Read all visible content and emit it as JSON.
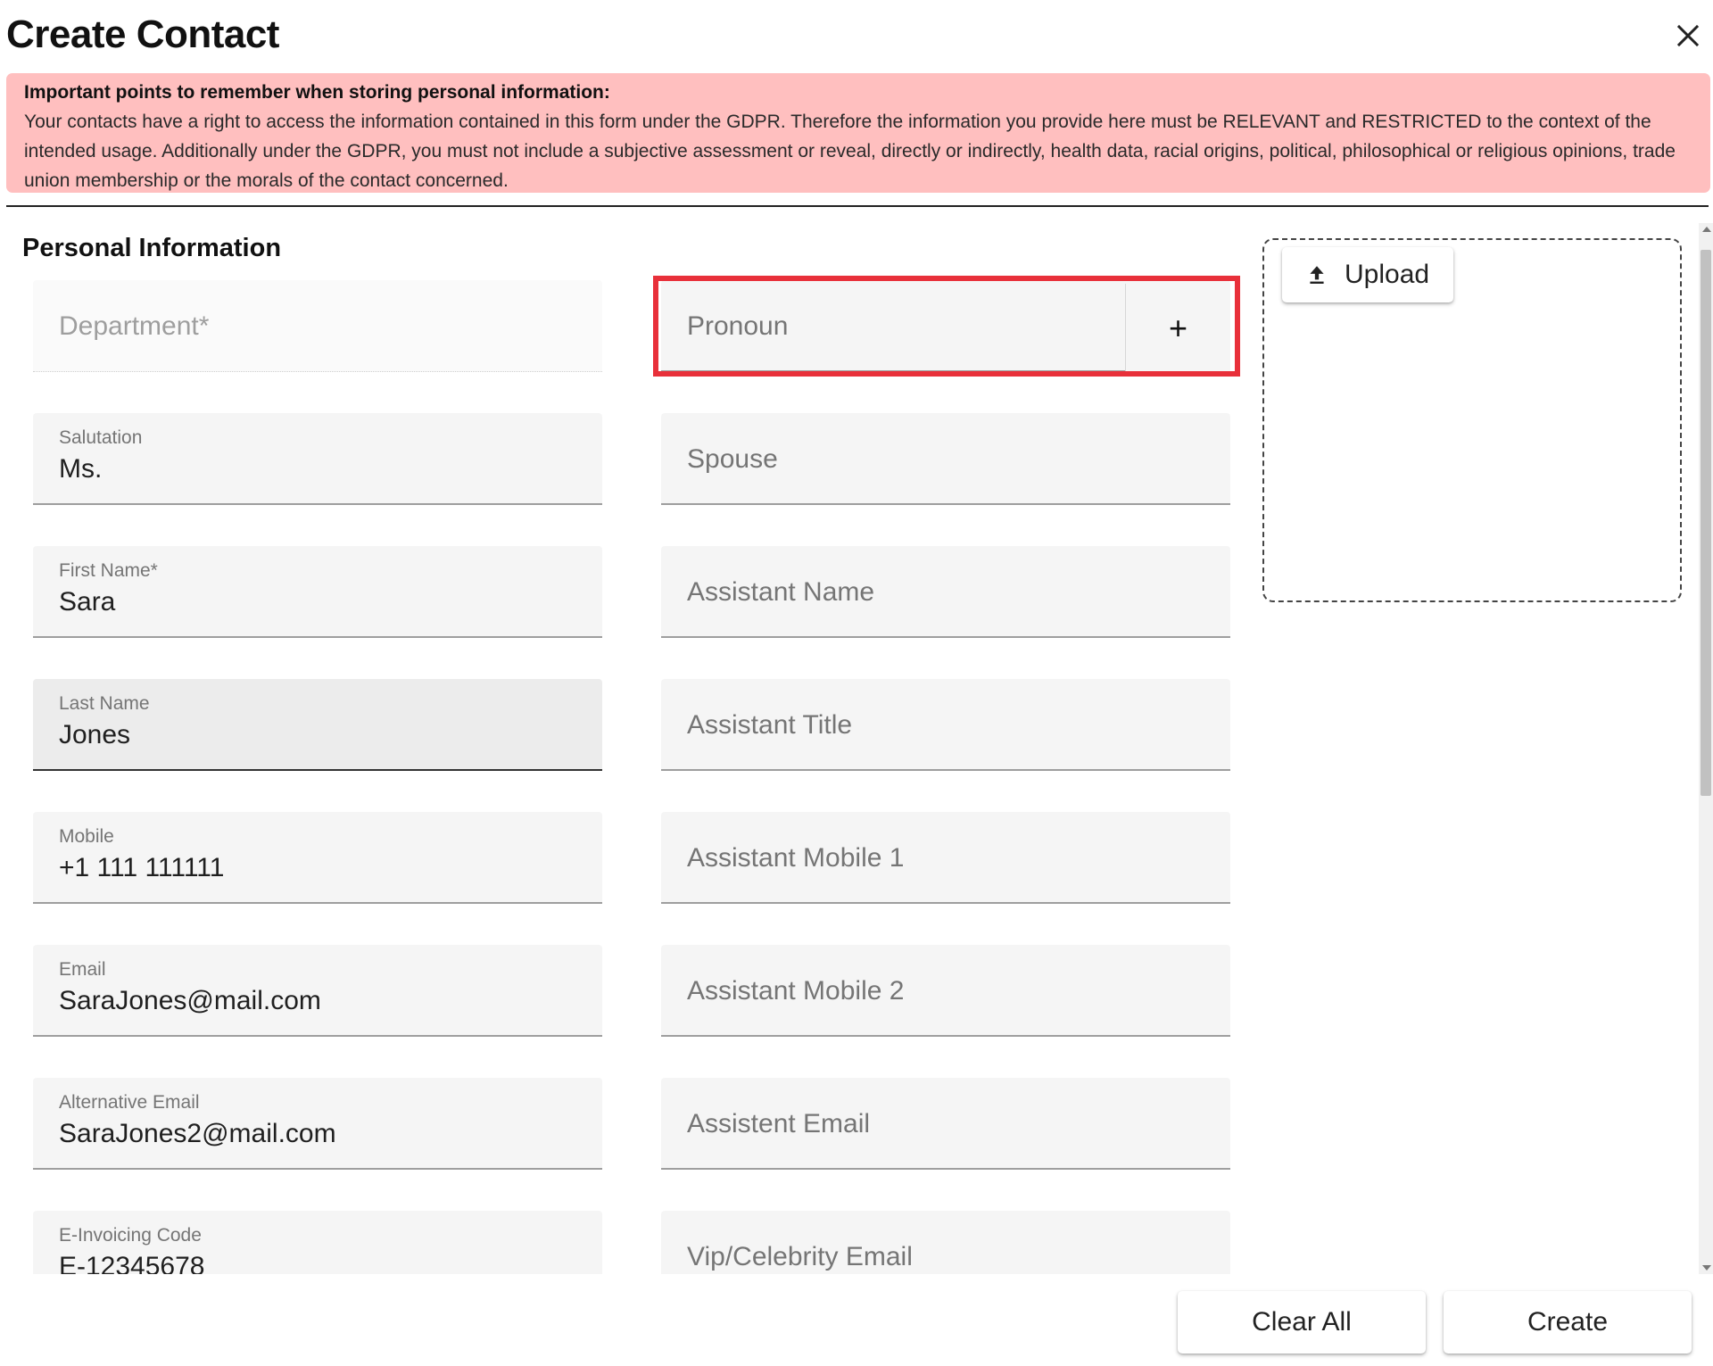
{
  "dialog": {
    "title": "Create Contact",
    "close_icon": "close-icon"
  },
  "gdpr_notice": {
    "heading": "Important points to remember when storing personal information:",
    "body": "Your contacts have a right to access the information contained in this form under the GDPR. Therefore the information you provide here must be RELEVANT and RESTRICTED to the context of the intended usage. Additionally under the GDPR, you must not include a subjective assessment or reveal, directly or indirectly, health data, racial origins, political, philosophical or religious opinions, trade union membership or the morals of the contact concerned.",
    "background_color": "#ffbfbf"
  },
  "section": {
    "title": "Personal Information"
  },
  "left_fields": {
    "department": {
      "placeholder": "Department*"
    },
    "salutation": {
      "label": "Salutation",
      "value": "Ms."
    },
    "first_name": {
      "label": "First Name*",
      "value": "Sara"
    },
    "last_name": {
      "label": "Last Name",
      "value": "Jones"
    },
    "mobile": {
      "label": "Mobile",
      "value": "+1 111 111111"
    },
    "email": {
      "label": "Email",
      "value": "SaraJones@mail.com"
    },
    "alt_email": {
      "label": "Alternative Email",
      "value": "SaraJones2@mail.com"
    },
    "e_invoicing": {
      "label": "E-Invoicing Code",
      "value": "E-12345678"
    }
  },
  "right_fields": {
    "pronoun": {
      "placeholder": "Pronoun",
      "add_label": "+",
      "highlight_color": "#e8303a"
    },
    "spouse": {
      "placeholder": "Spouse"
    },
    "assistant_name": {
      "placeholder": "Assistant Name"
    },
    "assistant_title": {
      "placeholder": "Assistant Title"
    },
    "assistant_mobile_1": {
      "placeholder": "Assistant Mobile 1"
    },
    "assistant_mobile_2": {
      "placeholder": "Assistant Mobile 2"
    },
    "assistant_email": {
      "placeholder": "Assistent Email"
    },
    "vip_email": {
      "placeholder": "Vip/Celebrity Email"
    }
  },
  "upload": {
    "label": "Upload",
    "icon": "upload-icon"
  },
  "footer": {
    "clear_label": "Clear All",
    "create_label": "Create"
  }
}
